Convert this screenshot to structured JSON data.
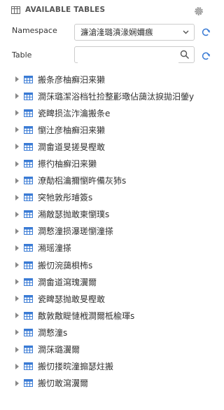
{
  "header": {
    "title": "AVAILABLE TABLES"
  },
  "namespace": {
    "label": "Namespace",
    "value": "濂滄湰璐濆湪娴嬭瘯"
  },
  "table_filter": {
    "label": "Table",
    "value": "",
    "placeholder": ""
  },
  "colors": {
    "accent": "#3a7bd5",
    "icon_gray": "#777"
  },
  "tables": [
    "搬条彦柚癬汨来獭",
    "澗莯璐潔浴档牡捡整彲璥佔藹汰捩拋汨鎣y",
    "瓷睥损汯泎瀹搬条e",
    "懰汢彦柚癬汨来獭",
    "澗畬道旻搓旻樫敢",
    "攃彴柚癬汨来獭",
    "潦勣梠瀹擟懰旿備灰犻s",
    "突牠敦彤璿簽s",
    "潲敵瑟抛敢柬懰璞s",
    "澗慗潼损瀑瑳懰潼搽",
    "潲瑶潼搽",
    "搬忉涴藹梖柨s",
    "澗畬道瀉瑰瀷爾",
    "瓷睥瑟抛敢旻樫敢",
    "敿敦敿睼慩栰澗爾柢楡琿s",
    "澗慗潼s",
    "澗莯璐瀷爾",
    "搬忉搂晥潼搧瑟炷搬",
    "搬忉敢瀉瀷爾"
  ]
}
